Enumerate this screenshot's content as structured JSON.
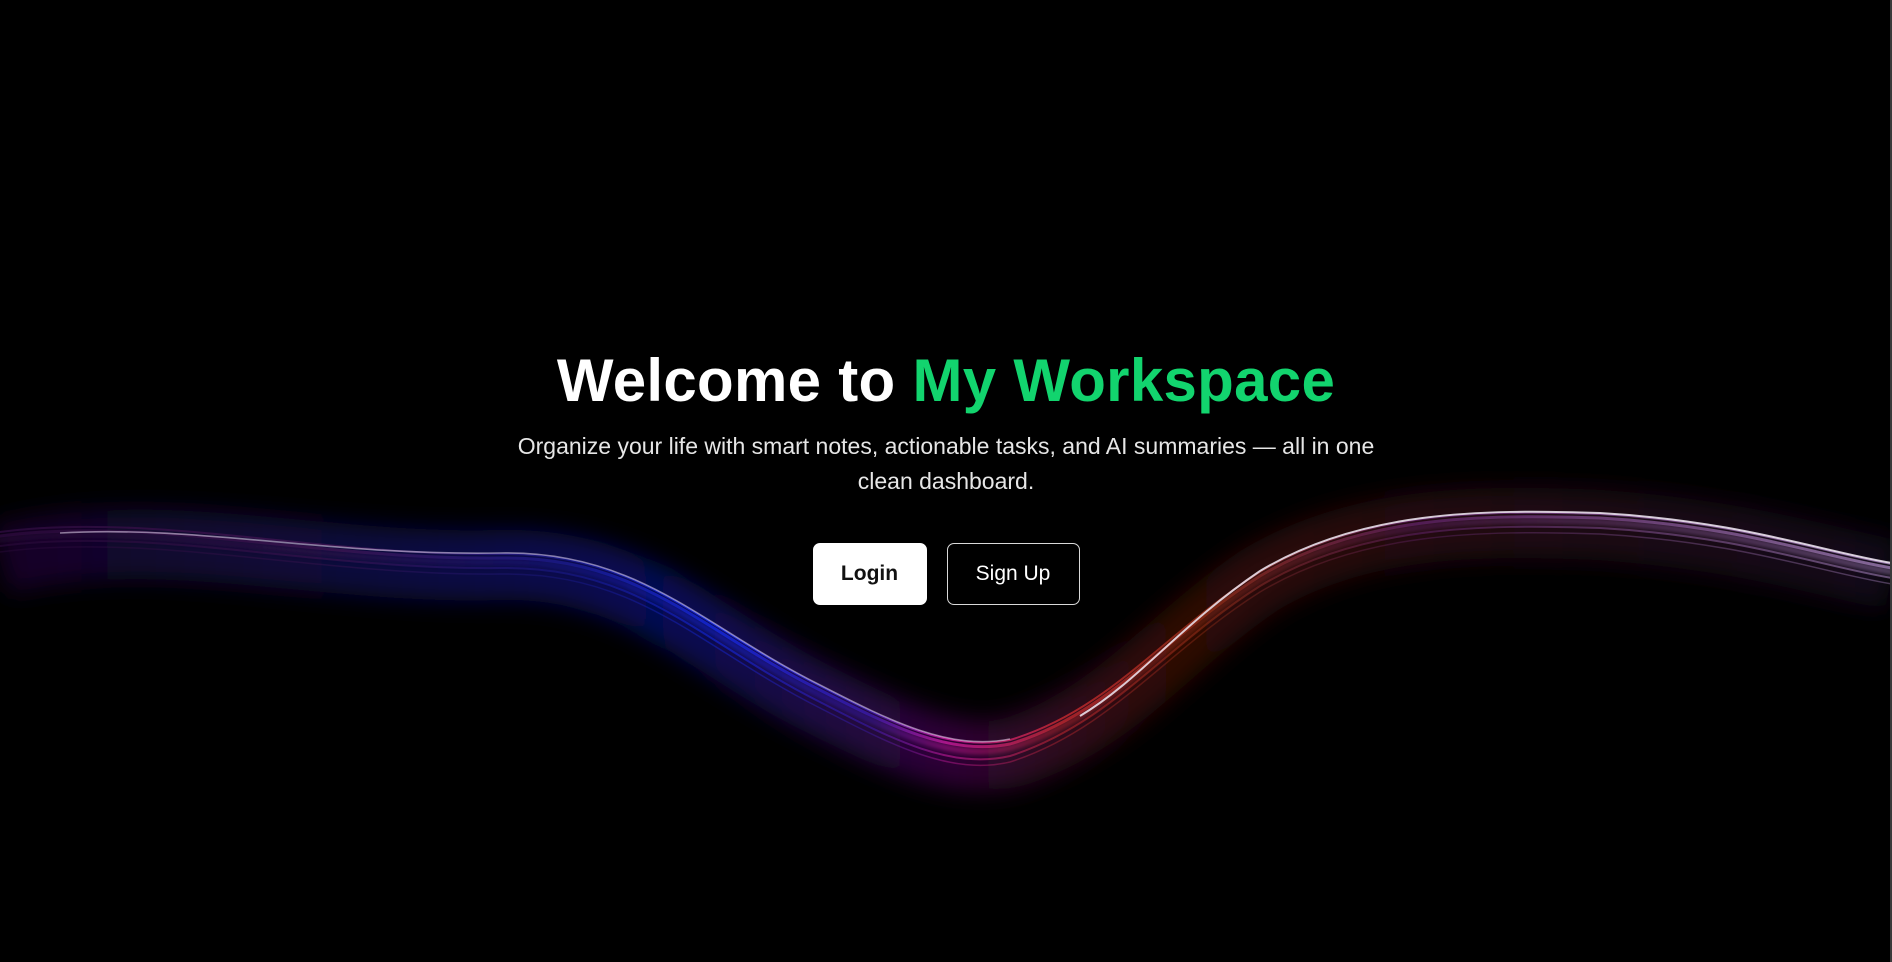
{
  "hero": {
    "title_prefix": "Welcome to ",
    "title_accent": "My Workspace",
    "subtitle": "Organize your life with smart notes, actionable tasks, and AI summaries — all in one clean dashboard."
  },
  "actions": {
    "login_label": "Login",
    "signup_label": "Sign Up"
  },
  "colors": {
    "background": "#000000",
    "accent": "#12d46e",
    "text": "#ffffff",
    "subtitle": "#e6e6e6"
  }
}
